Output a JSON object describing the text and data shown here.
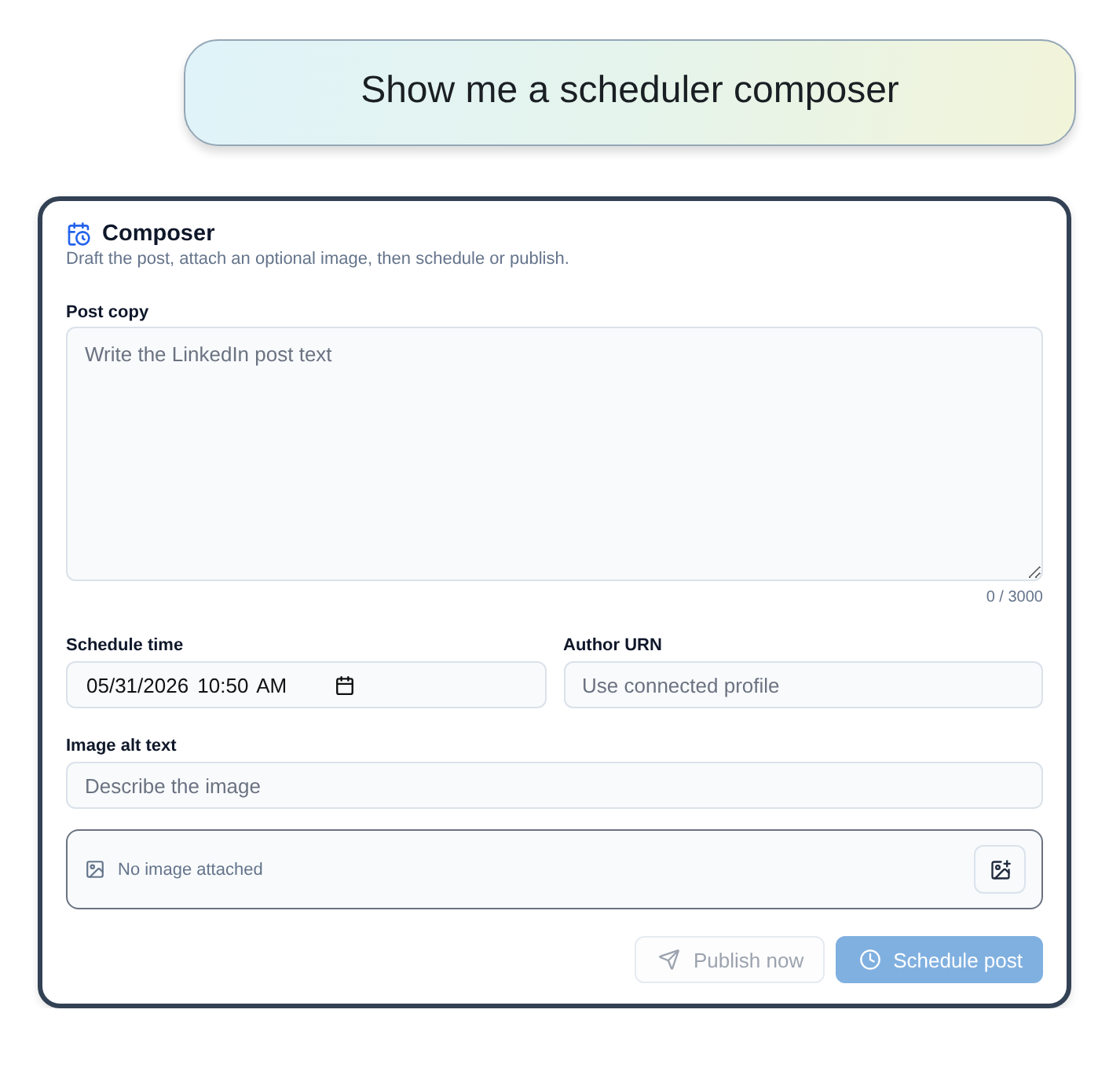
{
  "prompt": {
    "text": "Show me a scheduler composer"
  },
  "composer": {
    "title": "Composer",
    "subtitle": "Draft the post, attach an optional image, then schedule or publish.",
    "post_copy": {
      "label": "Post copy",
      "placeholder": "Write the LinkedIn post text",
      "counter": "0 / 3000"
    },
    "schedule_time": {
      "label": "Schedule time",
      "value": "05/31/2026 10:50 AM"
    },
    "author_urn": {
      "label": "Author URN",
      "placeholder": "Use connected profile"
    },
    "image_alt_text": {
      "label": "Image alt text",
      "placeholder": "Describe the image"
    },
    "image_attachment": {
      "status": "No image attached"
    },
    "buttons": [
      {
        "label": "Publish now",
        "kind": "secondary",
        "disabled": true
      },
      {
        "label": "Schedule post",
        "kind": "primary",
        "disabled": true
      }
    ]
  }
}
